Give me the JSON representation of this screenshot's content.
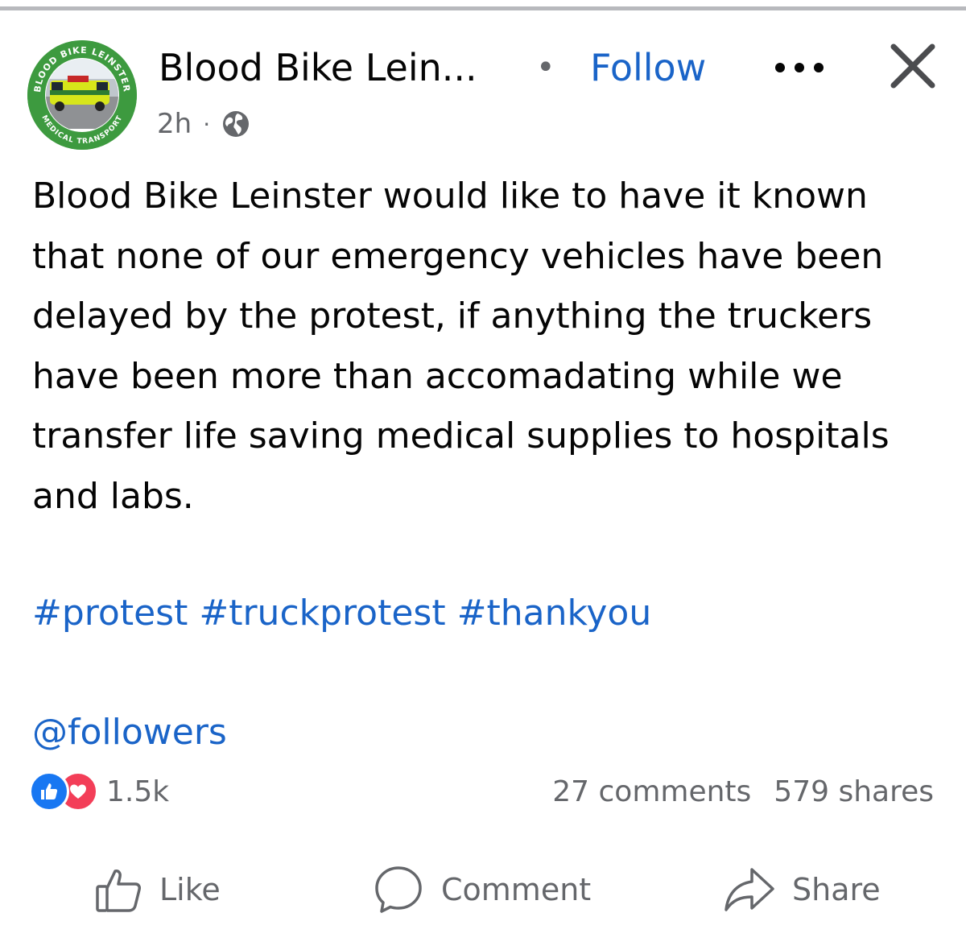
{
  "post": {
    "author": {
      "name": "Blood Bike Lein...",
      "avatar_ring_text_top": "BLOOD BIKE LEINSTER",
      "avatar_ring_text_bottom": "MEDICAL TRANSPORT"
    },
    "separator": "•",
    "follow_label": "Follow",
    "more_icon": "more-horizontal-icon",
    "close_icon": "close-icon",
    "timestamp": "2h",
    "meta_separator": "·",
    "privacy_icon": "globe-icon",
    "text": "Blood Bike Leinster would like to have it known that none of our emergency vehicles have been delayed by the protest, if anything the truckers have been more than accomadating while we transfer life saving medical supplies to hospitals and labs.",
    "hashtags": [
      "#protest",
      "#truckprotest",
      "#thankyou"
    ],
    "mention": "@followers"
  },
  "reactions": {
    "icons": [
      "like-reaction-icon",
      "love-reaction-icon"
    ],
    "count": "1.5k"
  },
  "engagement": {
    "comments": "27 comments",
    "shares": "579 shares"
  },
  "actions": {
    "like": "Like",
    "comment": "Comment",
    "share": "Share"
  },
  "colors": {
    "link": "#1a64c8",
    "secondary_text": "#65676b",
    "like_blue": "#1877f2",
    "love_red": "#f33e58",
    "avatar_green": "#3d9a3f"
  }
}
